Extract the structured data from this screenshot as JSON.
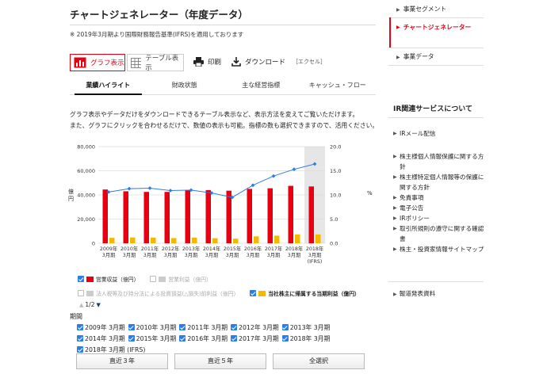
{
  "page": {
    "title": "チャートジェネレーター（年度データ）",
    "note": "※ 2019年3月期より国際財務報告基準(IFRS)を適用しております"
  },
  "view": {
    "graph_label": "グラフ表示",
    "table_label": "テーブル表示",
    "print_label": "印刷",
    "download_label": "ダウンロード",
    "download_sub": "［エクセル］"
  },
  "tabs": [
    "業績ハイライト",
    "財政状態",
    "主な経営指標",
    "キャッシュ・フロー"
  ],
  "description": [
    "グラフ表示やデータだけをダウンロードできるテーブル表示など、表示方法を変えてご覧いただけます。",
    "また、グラフにクリックを合わせるだけで、数値の表示も可能。指標の数も選択できますので、活用ください。"
  ],
  "chart_data": {
    "type": "bar",
    "categories": [
      "2009年3月期",
      "2010年3月期",
      "2011年3月期",
      "2012年3月期",
      "2013年3月期",
      "2014年3月期",
      "2015年3月期",
      "2016年3月期",
      "2017年3月期",
      "2018年3月期",
      "2018年3月期(IFRS)"
    ],
    "category_lines": [
      [
        "2009年",
        "3月期"
      ],
      [
        "2010年",
        "3月期"
      ],
      [
        "2011年",
        "3月期"
      ],
      [
        "2012年",
        "3月期"
      ],
      [
        "2013年",
        "3月期"
      ],
      [
        "2014年",
        "3月期"
      ],
      [
        "2015年",
        "3月期"
      ],
      [
        "2016年",
        "3月期"
      ],
      [
        "2017年",
        "3月期"
      ],
      [
        "2018年",
        "3月期"
      ],
      [
        "2018年",
        "3月期",
        "(IFRS)"
      ]
    ],
    "series": [
      {
        "name": "営業収益（億円）",
        "axis": "left",
        "kind": "bar",
        "color": "#e60012",
        "values": [
          44500,
          43000,
          42500,
          42500,
          44000,
          44000,
          43500,
          45000,
          45500,
          47500,
          47000
        ]
      },
      {
        "name": "当社株主に帰属する当期利益（億円）",
        "axis": "left",
        "kind": "bar",
        "color": "#f5b800",
        "values": [
          4500,
          4800,
          4700,
          4300,
          4700,
          4200,
          3800,
          5700,
          6300,
          7300,
          7300
        ]
      },
      {
        "name": "",
        "axis": "right",
        "kind": "line",
        "color": "#2b7de9",
        "values": [
          10.6,
          11.3,
          11.4,
          10.9,
          11.0,
          10.4,
          9.5,
          12.0,
          13.9,
          15.3,
          16.4
        ]
      }
    ],
    "y_left": {
      "min": 0,
      "max": 80000,
      "ticks": [
        "0",
        "20,000",
        "40,000",
        "60,000",
        "80,000"
      ],
      "label": "億円"
    },
    "y_right": {
      "min": 0,
      "max": 20,
      "ticks": [
        "0.0",
        "5.0",
        "10.0",
        "15.0",
        "20.0"
      ],
      "label": "%"
    },
    "highlight_index": 10,
    "grid": true
  },
  "legend": {
    "items": [
      {
        "label": "営業収益（億円）",
        "checked": true,
        "color": "#e60012"
      },
      {
        "label": "営業利益（億円）",
        "checked": false,
        "color": "#cccccc"
      },
      {
        "label": "法人税等及び持分法による投資損益(△損失)前利益（億円）",
        "checked": false,
        "color": "#cccccc"
      },
      {
        "label": "当社株主に帰属する当期利益（億円）",
        "checked": true,
        "color": "#f5b800"
      }
    ],
    "pager": "1/2"
  },
  "periods": {
    "label": "期間",
    "items": [
      "2009年 3月期",
      "2010年 3月期",
      "2011年 3月期",
      "2012年 3月期",
      "2013年 3月期",
      "2014年 3月期",
      "2015年 3月期",
      "2016年 3月期",
      "2017年 3月期",
      "2018年 3月期",
      "2018年 3月期 (IFRS)"
    ]
  },
  "range_buttons": [
    "直近３年",
    "直近５年",
    "全選択"
  ],
  "sidebar": {
    "items": [
      "事業セグメント",
      "チャートジェネレーター",
      "事業データ"
    ],
    "active_index": 1,
    "ir_title": "IR関連サービスについて",
    "ir_items": [
      "IRメール配信",
      "株主様個人情報保護に関する方針",
      "株主様特定個人情報等の保護に関する方針",
      "免責事項",
      "電子公告",
      "IRポリシー",
      "取引所規則の遵守に関する確認書",
      "株主・投資家情報サイトマップ"
    ],
    "news": "報道発表資料"
  }
}
